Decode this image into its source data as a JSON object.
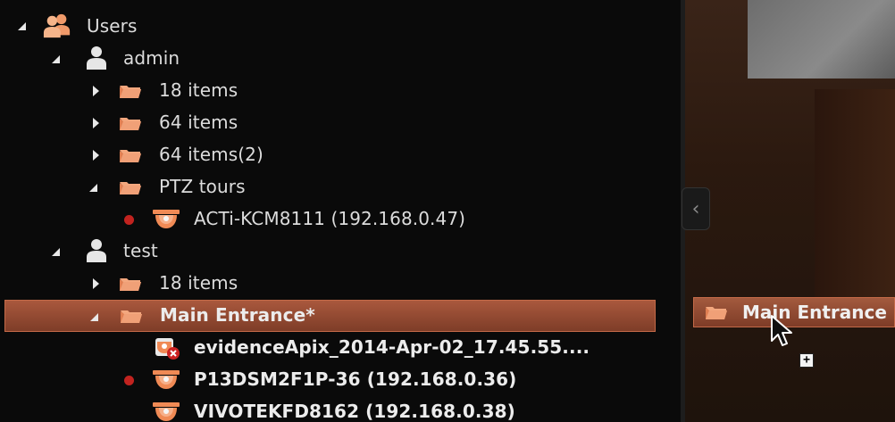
{
  "tree": {
    "users": {
      "label": "Users"
    },
    "admin": {
      "label": "admin",
      "folders": [
        {
          "label": "18 items"
        },
        {
          "label": "64 items"
        },
        {
          "label": "64 items(2)"
        }
      ],
      "ptz": {
        "label": "PTZ tours",
        "camera": {
          "label": "ACTi-KCM8111 (192.168.0.47)"
        }
      }
    },
    "test": {
      "label": "test",
      "folder": {
        "label": "18 items"
      },
      "main_entrance": {
        "label": "Main Entrance*",
        "children": [
          {
            "label": "evidenceApix_2014-Apr-02_17.45.55...."
          },
          {
            "label": "P13DSM2F1P-36 (192.168.0.36)"
          },
          {
            "label": "VIVOTEKFD8162 (192.168.0.38)"
          }
        ]
      }
    }
  },
  "drag_ghost": {
    "label": "Main Entrance"
  },
  "panel": {
    "collapse_glyph": "‹"
  },
  "cursor": {
    "badge": "+"
  },
  "colors": {
    "accent": "#a9583d",
    "folder": "#e8956a",
    "recording_dot": "#c2231f"
  }
}
